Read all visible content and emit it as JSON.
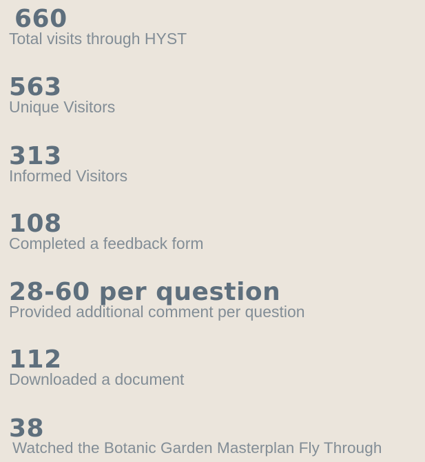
{
  "stats": [
    {
      "value": "660",
      "label": "Total visits through HYST"
    },
    {
      "value": "563",
      "label": "Unique Visitors"
    },
    {
      "value": "313",
      "label": "Informed Visitors"
    },
    {
      "value": "108",
      "label": "Completed a feedback form"
    },
    {
      "value": "28-60 per question",
      "label": "Provided additional comment  per question"
    },
    {
      "value": "112",
      "label": "Downloaded a document"
    },
    {
      "value": "38",
      "label": "Watched the Botanic Garden Masterplan Fly Through"
    }
  ]
}
